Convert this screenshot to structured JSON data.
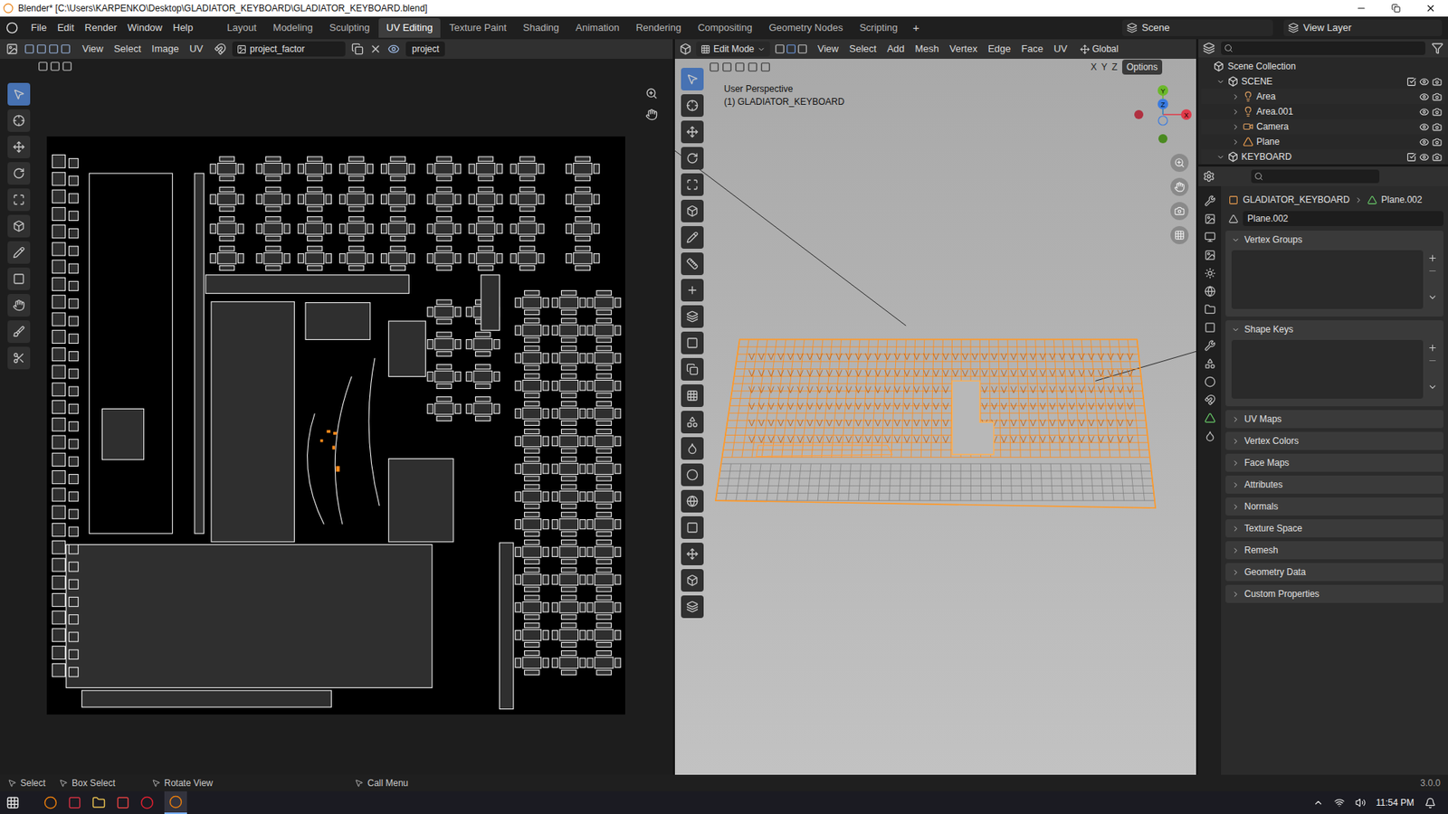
{
  "window": {
    "title": "Blender* [C:\\Users\\KARPENKO\\Desktop\\GLADIATOR_KEYBOARD\\GLADIATOR_KEYBOARD.blend]"
  },
  "menu": [
    "File",
    "Edit",
    "Render",
    "Window",
    "Help"
  ],
  "workspaces": [
    {
      "label": "Layout",
      "selected": false
    },
    {
      "label": "Modeling",
      "selected": false
    },
    {
      "label": "Sculpting",
      "selected": false
    },
    {
      "label": "UV Editing",
      "selected": true
    },
    {
      "label": "Texture Paint",
      "selected": false
    },
    {
      "label": "Shading",
      "selected": false
    },
    {
      "label": "Animation",
      "selected": false
    },
    {
      "label": "Rendering",
      "selected": false
    },
    {
      "label": "Compositing",
      "selected": false
    },
    {
      "label": "Geometry Nodes",
      "selected": false
    },
    {
      "label": "Scripting",
      "selected": false
    }
  ],
  "add_workspace": "+",
  "scene": "Scene",
  "view_layer": "View Layer",
  "uv_editor": {
    "menus": [
      "View",
      "Select",
      "Image",
      "UV"
    ],
    "image_name": "project_factor",
    "uv_map": "project"
  },
  "viewport": {
    "mode": "Edit Mode",
    "menus": [
      "View",
      "Select",
      "Add",
      "Mesh",
      "Vertex",
      "Edge",
      "Face",
      "UV"
    ],
    "orientation": "Global",
    "mirror_axes": [
      "X",
      "Y",
      "Z"
    ],
    "options": "Options",
    "perspective": "User Perspective",
    "object": "(1) GLADIATOR_KEYBOARD",
    "gizmo_axes": [
      "X",
      "Y",
      "Z"
    ]
  },
  "outliner": {
    "root": "Scene Collection",
    "items": [
      {
        "name": "SCENE",
        "kind": "collection",
        "depth": 0,
        "expanded": true,
        "checked": true,
        "visible": true
      },
      {
        "name": "Area",
        "kind": "light",
        "depth": 1,
        "expanded": false,
        "checked": true,
        "visible": true
      },
      {
        "name": "Area.001",
        "kind": "light",
        "depth": 1,
        "expanded": false,
        "checked": true,
        "visible": true
      },
      {
        "name": "Camera",
        "kind": "camera",
        "depth": 1,
        "expanded": false,
        "checked": true,
        "visible": true
      },
      {
        "name": "Plane",
        "kind": "mesh",
        "depth": 1,
        "expanded": false,
        "checked": true,
        "visible": true
      },
      {
        "name": "KEYBOARD",
        "kind": "collection",
        "depth": 0,
        "expanded": true,
        "checked": true,
        "visible": true
      }
    ]
  },
  "properties": {
    "breadcrumb": [
      "GLADIATOR_KEYBOARD",
      "Plane.002"
    ],
    "mesh_name": "Plane.002",
    "panels": [
      {
        "label": "Vertex Groups",
        "expanded": true
      },
      {
        "label": "Shape Keys",
        "expanded": true
      },
      {
        "label": "UV Maps",
        "expanded": false
      },
      {
        "label": "Vertex Colors",
        "expanded": false
      },
      {
        "label": "Face Maps",
        "expanded": false
      },
      {
        "label": "Attributes",
        "expanded": false
      },
      {
        "label": "Normals",
        "expanded": false
      },
      {
        "label": "Texture Space",
        "expanded": false
      },
      {
        "label": "Remesh",
        "expanded": false
      },
      {
        "label": "Geometry Data",
        "expanded": false
      },
      {
        "label": "Custom Properties",
        "expanded": false
      }
    ]
  },
  "status_bar": {
    "hints": [
      "Select",
      "Box Select",
      "Rotate View",
      "Call Menu"
    ],
    "version": "3.0.0"
  },
  "taskbar": {
    "time": "11:54 PM"
  }
}
